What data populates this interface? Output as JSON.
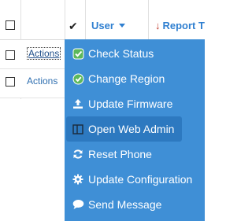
{
  "table": {
    "header": {
      "check_glyph": "✔",
      "user_label": "User",
      "report_label": "Report Ti",
      "report_sort_glyph": "↓"
    },
    "rows": [
      {
        "actions_label": "Actions"
      },
      {
        "actions_label": "Actions"
      }
    ]
  },
  "menu": {
    "background_color": "#3f8fd6",
    "items": [
      {
        "label": "Check Status",
        "icon": "check-status-icon"
      },
      {
        "label": "Change Region",
        "icon": "change-region-icon"
      },
      {
        "label": "Update Firmware",
        "icon": "upload-icon"
      },
      {
        "label": "Open Web Admin",
        "icon": "window-icon",
        "hovered": true
      },
      {
        "label": "Reset Phone",
        "icon": "refresh-icon"
      },
      {
        "label": "Update Configuration",
        "icon": "gear-icon"
      },
      {
        "label": "Send Message",
        "icon": "comment-icon"
      }
    ]
  }
}
